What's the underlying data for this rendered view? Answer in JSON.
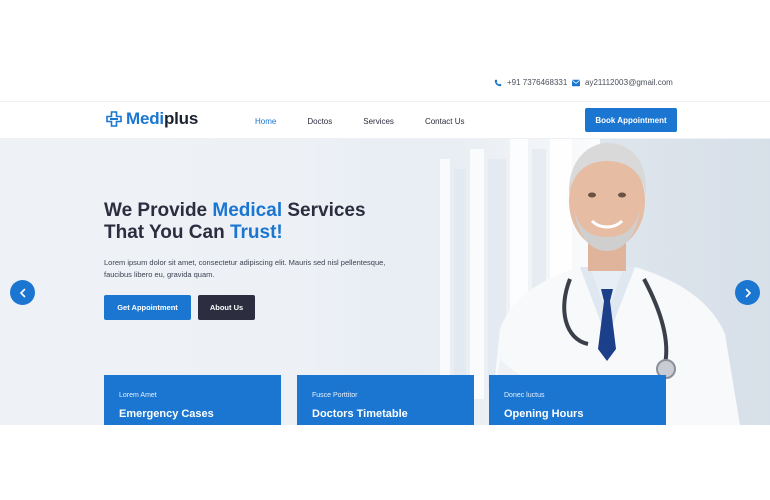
{
  "topbar": {
    "phone": "+91 7376468331",
    "email": "ay2111200З@gmail.com"
  },
  "brand": {
    "name_part1": "Medi",
    "name_part2": "plus",
    "accent": "#1a76d1",
    "dark": "#2c2d3f"
  },
  "nav": {
    "items": [
      {
        "label": "Home",
        "active": true
      },
      {
        "label": "Doctos",
        "active": false
      },
      {
        "label": "Services",
        "active": false
      },
      {
        "label": "Contact Us",
        "active": false
      }
    ],
    "book_label": "Book Appointment"
  },
  "hero": {
    "title_line1_a": "We Provide ",
    "title_line1_b": "Medical",
    "title_line1_c": " Services",
    "title_line2_a": "That You Can ",
    "title_line2_b": "Trust!",
    "description": "Lorem ipsum dolor sit amet, consectetur adipiscing elit. Mauris sed nisl pellentesque, faucibus libero eu, gravida quam.",
    "btn_primary": "Get Appointment",
    "btn_secondary": "About Us"
  },
  "cards": [
    {
      "sub": "Lorem Amet",
      "title": "Emergency Cases"
    },
    {
      "sub": "Fusce Porttitor",
      "title": "Doctors Timetable"
    },
    {
      "sub": "Donec luctus",
      "title": "Opening Hours"
    }
  ],
  "icons": [
    "phone-icon",
    "mail-icon",
    "logo-cross-icon",
    "chevron-left-icon",
    "chevron-right-icon"
  ]
}
